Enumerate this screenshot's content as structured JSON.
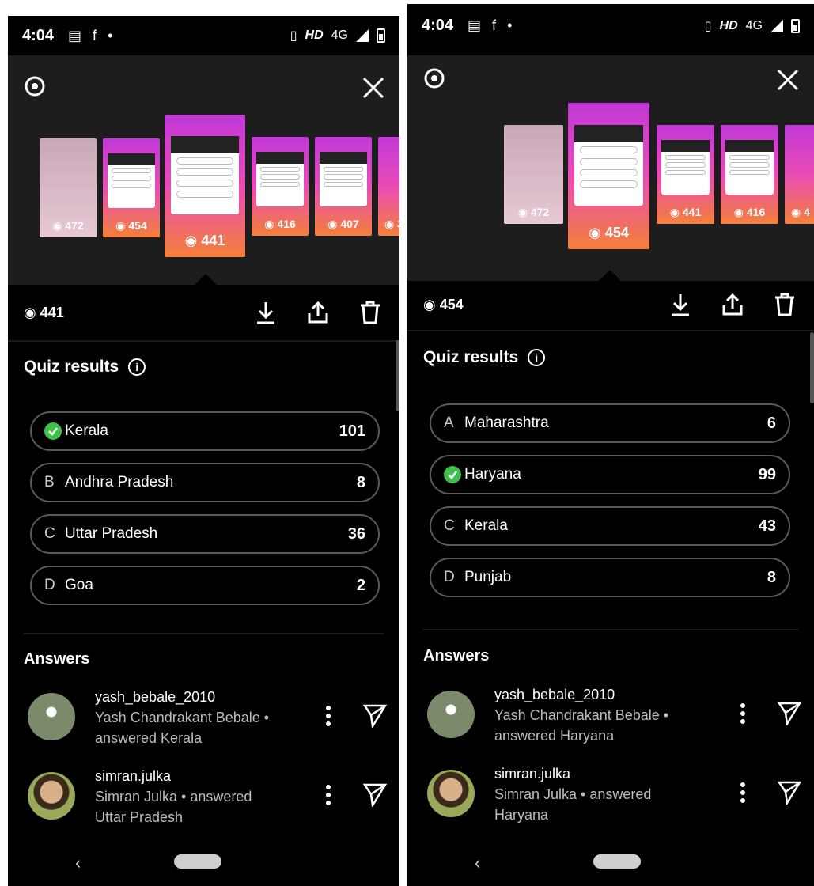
{
  "left": {
    "status": {
      "time": "4:04",
      "net": "HD",
      "net2": "4G"
    },
    "thumbs": [
      "472",
      "454",
      "441",
      "416",
      "407",
      "3"
    ],
    "views": "441",
    "quiz_title": "Quiz results",
    "options": [
      {
        "letter": "",
        "name": "Kerala",
        "count": "101",
        "correct": true
      },
      {
        "letter": "B",
        "name": "Andhra Pradesh",
        "count": "8"
      },
      {
        "letter": "C",
        "name": "Uttar Pradesh",
        "count": "36"
      },
      {
        "letter": "D",
        "name": "Goa",
        "count": "2"
      }
    ],
    "answers_title": "Answers",
    "answers": [
      {
        "handle": "yash_bebale_2010",
        "detail": "Yash Chandrakant Bebale • answered Kerala"
      },
      {
        "handle": "simran.julka",
        "detail": "Simran Julka • answered Uttar Pradesh"
      }
    ]
  },
  "right": {
    "status": {
      "time": "4:04",
      "net": "HD",
      "net2": "4G"
    },
    "thumbs": [
      "472",
      "454",
      "441",
      "416",
      "4"
    ],
    "views": "454",
    "quiz_title": "Quiz results",
    "options": [
      {
        "letter": "A",
        "name": "Maharashtra",
        "count": "6"
      },
      {
        "letter": "",
        "name": "Haryana",
        "count": "99",
        "correct": true
      },
      {
        "letter": "C",
        "name": "Kerala",
        "count": "43"
      },
      {
        "letter": "D",
        "name": "Punjab",
        "count": "8"
      }
    ],
    "answers_title": "Answers",
    "answers": [
      {
        "handle": "yash_bebale_2010",
        "detail": "Yash Chandrakant Bebale • answered Haryana"
      },
      {
        "handle": "simran.julka",
        "detail": "Simran Julka • answered Haryana"
      }
    ]
  },
  "colors": {
    "correct": "#3fbf4c",
    "gradient_top": "#c138d8",
    "gradient_bottom": "#f4803a"
  },
  "icons": [
    "gear-icon",
    "close-icon",
    "eye-icon",
    "download-icon",
    "share-icon",
    "trash-icon",
    "info-icon",
    "check-icon",
    "kebab-icon",
    "send-icon",
    "back-icon"
  ]
}
